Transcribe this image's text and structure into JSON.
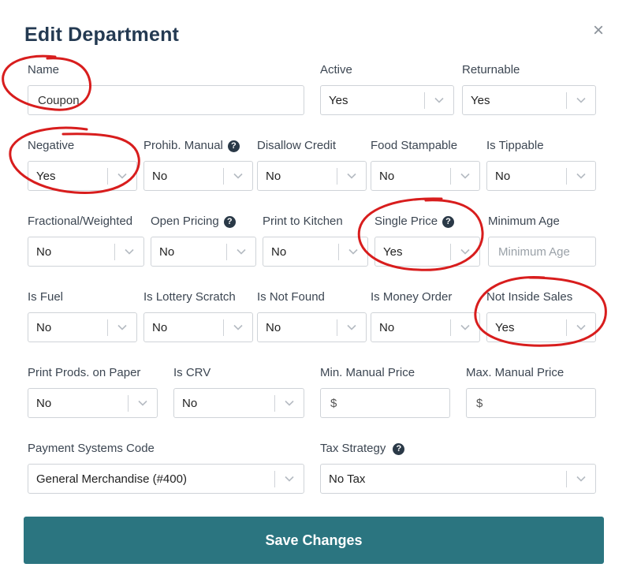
{
  "dialog": {
    "title": "Edit Department",
    "close_glyph": "×"
  },
  "fields": {
    "name": {
      "label": "Name",
      "value": "Coupon"
    },
    "active": {
      "label": "Active",
      "value": "Yes"
    },
    "returnable": {
      "label": "Returnable",
      "value": "Yes"
    },
    "negative": {
      "label": "Negative",
      "value": "Yes"
    },
    "prohib_manual": {
      "label": "Prohib. Manual",
      "value": "No"
    },
    "disallow_credit": {
      "label": "Disallow Credit",
      "value": "No"
    },
    "food_stampable": {
      "label": "Food Stampable",
      "value": "No"
    },
    "is_tippable": {
      "label": "Is Tippable",
      "value": "No"
    },
    "fractional_weighted": {
      "label": "Fractional/Weighted",
      "value": "No"
    },
    "open_pricing": {
      "label": "Open Pricing",
      "value": "No"
    },
    "print_to_kitchen": {
      "label": "Print to Kitchen",
      "value": "No"
    },
    "single_price": {
      "label": "Single Price",
      "value": "Yes"
    },
    "minimum_age": {
      "label": "Minimum Age",
      "placeholder": "Minimum Age"
    },
    "is_fuel": {
      "label": "Is Fuel",
      "value": "No"
    },
    "is_lottery_scratch": {
      "label": "Is Lottery Scratch",
      "value": "No"
    },
    "is_not_found": {
      "label": "Is Not Found",
      "value": "No"
    },
    "is_money_order": {
      "label": "Is Money Order",
      "value": "No"
    },
    "not_inside_sales": {
      "label": "Not Inside Sales",
      "value": "Yes"
    },
    "print_prods_on_paper": {
      "label": "Print Prods. on Paper",
      "value": "No"
    },
    "is_crv": {
      "label": "Is CRV",
      "value": "No"
    },
    "min_manual_price": {
      "label": "Min. Manual Price",
      "prefix": "$"
    },
    "max_manual_price": {
      "label": "Max. Manual Price",
      "prefix": "$"
    },
    "payment_systems_code": {
      "label": "Payment Systems Code",
      "value": "General Merchandise (#400)"
    },
    "tax_strategy": {
      "label": "Tax Strategy",
      "value": "No Tax"
    }
  },
  "help_glyph": "?",
  "actions": {
    "save_label": "Save Changes"
  },
  "colors": {
    "primary": "#2b7580",
    "title": "#243a52",
    "annotation": "#d81d1d"
  },
  "annotations": [
    "name",
    "negative",
    "single_price",
    "not_inside_sales"
  ]
}
